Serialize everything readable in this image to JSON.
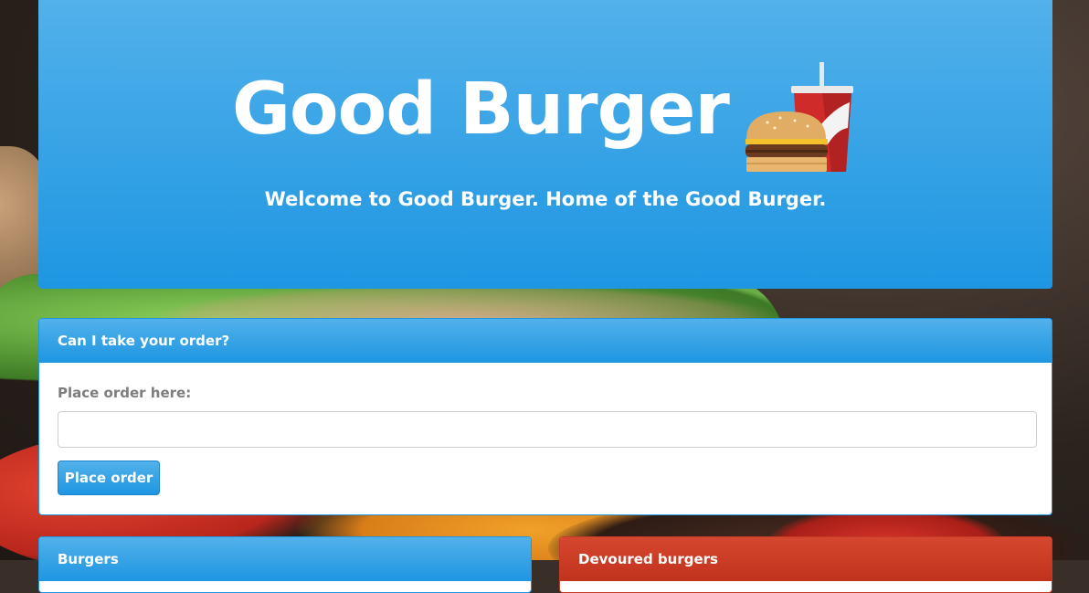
{
  "header": {
    "title": "Good Burger",
    "tagline": "Welcome to Good Burger. Home of the Good Burger."
  },
  "order_panel": {
    "heading": "Can I take your order?",
    "label": "Place order here:",
    "input_value": "",
    "input_placeholder": "",
    "button_label": "Place order"
  },
  "burgers_panel": {
    "heading": "Burgers"
  },
  "devoured_panel": {
    "heading": "Devoured burgers"
  },
  "colors": {
    "primary_blue": "#1e96e2",
    "light_blue": "#52b1ea",
    "devoured_red": "#c1321d"
  },
  "icons": {
    "logo": "burger-and-soda-icon"
  }
}
